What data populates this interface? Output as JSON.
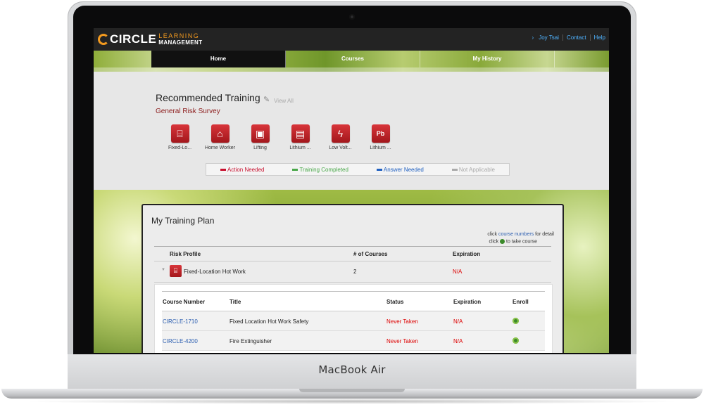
{
  "device": {
    "label": "MacBook Air"
  },
  "app": {
    "logo": {
      "word": "CIRCLE",
      "sub1": "LEARNING",
      "sub2": "MANAGEMENT"
    },
    "toplinks": {
      "user": "Joy Tsai",
      "contact": "Contact",
      "help": "Help"
    },
    "nav": {
      "home": "Home",
      "courses": "Courses",
      "history": "My History"
    }
  },
  "recommended": {
    "title": "Recommended Training",
    "view_all": "View All",
    "subtitle": "General Risk Survey",
    "items": [
      {
        "label": "Fixed-Lo...",
        "icon": "stairs-icon"
      },
      {
        "label": "Home Worker",
        "icon": "house-icon"
      },
      {
        "label": "Lifting",
        "icon": "lifting-icon"
      },
      {
        "label": "Lithium ...",
        "icon": "battery-icon"
      },
      {
        "label": "Low Volt...",
        "icon": "lightning-icon"
      },
      {
        "label": "Lithium ...",
        "icon": "lead-pb-icon"
      }
    ],
    "legend": {
      "action": "Action Needed",
      "completed": "Training Completed",
      "answer": "Answer Needed",
      "na": "Not Applicable"
    }
  },
  "plan": {
    "title": "My Training Plan",
    "hint_pre": "click",
    "hint_link": "course numbers",
    "hint_post": "for detail",
    "hint2_pre": "click",
    "hint2_post": "to take course",
    "headers": {
      "profile": "Risk Profile",
      "courses": "# of Courses",
      "expiration": "Expiration"
    },
    "row": {
      "name": "Fixed-Location Hot Work",
      "count": "2",
      "expiration": "N/A"
    },
    "inner_headers": {
      "number": "Course Number",
      "title": "Title",
      "status": "Status",
      "expiration": "Expiration",
      "enroll": "Enroll"
    },
    "courses": [
      {
        "number": "CIRCLE-1710",
        "title": "Fixed Location Hot Work Safety",
        "status": "Never Taken",
        "expiration": "N/A"
      },
      {
        "number": "CIRCLE-4200",
        "title": "Fire Extinguisher",
        "status": "Never Taken",
        "expiration": "N/A"
      }
    ]
  },
  "colors": {
    "accent_orange": "#f39a1f",
    "link_blue": "#2a5db0",
    "alert_red": "#d00000",
    "icon_red": "#c0242a"
  }
}
